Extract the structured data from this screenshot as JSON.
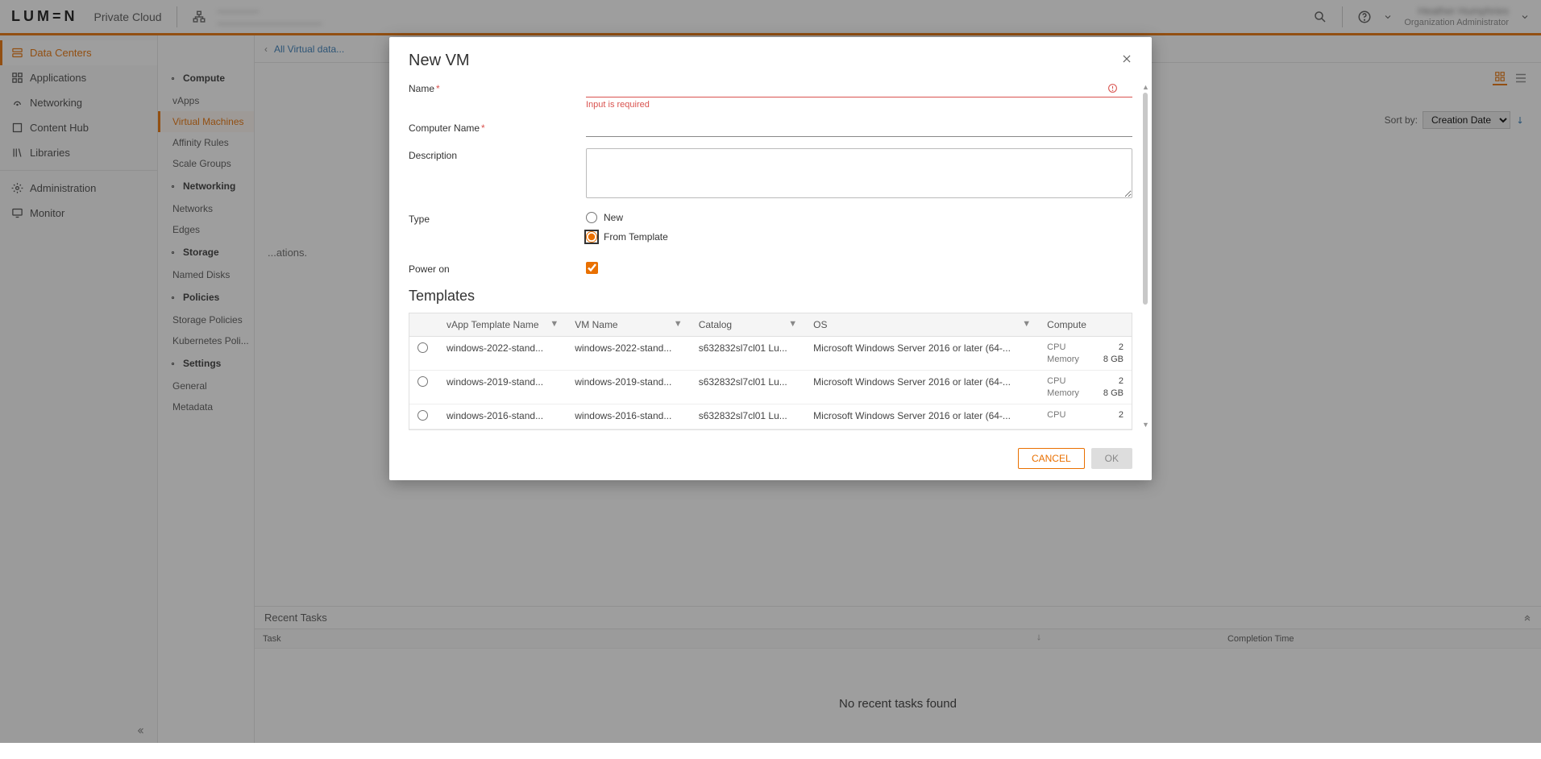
{
  "header": {
    "logo": "LUM=N",
    "product": "Private Cloud",
    "org_line1": "————",
    "org_line2": "——————————",
    "user_name": "Heather Humphries",
    "user_role": "Organization Administrator"
  },
  "leftnav": [
    {
      "label": "Data Centers",
      "active": true
    },
    {
      "label": "Applications"
    },
    {
      "label": "Networking"
    },
    {
      "label": "Content Hub"
    },
    {
      "label": "Libraries"
    },
    {
      "sep": true
    },
    {
      "label": "Administration"
    },
    {
      "label": "Monitor"
    }
  ],
  "breadcrumb": "All Virtual data...",
  "midnav": {
    "groups": [
      {
        "title": "Compute",
        "items": [
          "vApps",
          "Virtual Machines",
          "Affinity Rules",
          "Scale Groups"
        ],
        "active": "Virtual Machines"
      },
      {
        "title": "Networking",
        "items": [
          "Networks",
          "Edges"
        ]
      },
      {
        "title": "Storage",
        "items": [
          "Named Disks"
        ]
      },
      {
        "title": "Policies",
        "items": [
          "Storage Policies",
          "Kubernetes Poli..."
        ]
      },
      {
        "title": "Settings",
        "items": [
          "General",
          "Metadata"
        ]
      }
    ]
  },
  "content": {
    "sort_label": "Sort by:",
    "sort_value": "Creation Date",
    "hint_text": "...ations."
  },
  "tasks": {
    "header": "Recent Tasks",
    "cols": [
      "Task",
      "",
      "",
      "",
      "",
      "Completion Time"
    ],
    "none": "No recent tasks found"
  },
  "modal": {
    "title": "New VM",
    "fields": {
      "name_label": "Name",
      "name_err": "Input is required",
      "comp_label": "Computer Name",
      "desc_label": "Description",
      "type_label": "Type",
      "type_new": "New",
      "type_tpl": "From Template",
      "power_label": "Power on"
    },
    "templates_title": "Templates",
    "tpl_cols": {
      "c0": "",
      "c1": "vApp Template Name",
      "c2": "VM Name",
      "c3": "Catalog",
      "c4": "OS",
      "c5": "Compute"
    },
    "tpl_rows": [
      {
        "vapp": "windows-2022-stand...",
        "vm": "windows-2022-stand...",
        "cat": "s632832sl7cl01 Lu...",
        "os": "Microsoft Windows Server 2016 or later (64-...",
        "cpu": "2",
        "mem": "8 GB"
      },
      {
        "vapp": "windows-2019-stand...",
        "vm": "windows-2019-stand...",
        "cat": "s632832sl7cl01 Lu...",
        "os": "Microsoft Windows Server 2016 or later (64-...",
        "cpu": "2",
        "mem": "8 GB"
      },
      {
        "vapp": "windows-2016-stand...",
        "vm": "windows-2016-stand...",
        "cat": "s632832sl7cl01 Lu...",
        "os": "Microsoft Windows Server 2016 or later (64-...",
        "cpu": "2",
        "mem": ""
      }
    ],
    "compute_labels": {
      "cpu": "CPU",
      "mem": "Memory"
    },
    "buttons": {
      "cancel": "CANCEL",
      "ok": "OK"
    }
  }
}
